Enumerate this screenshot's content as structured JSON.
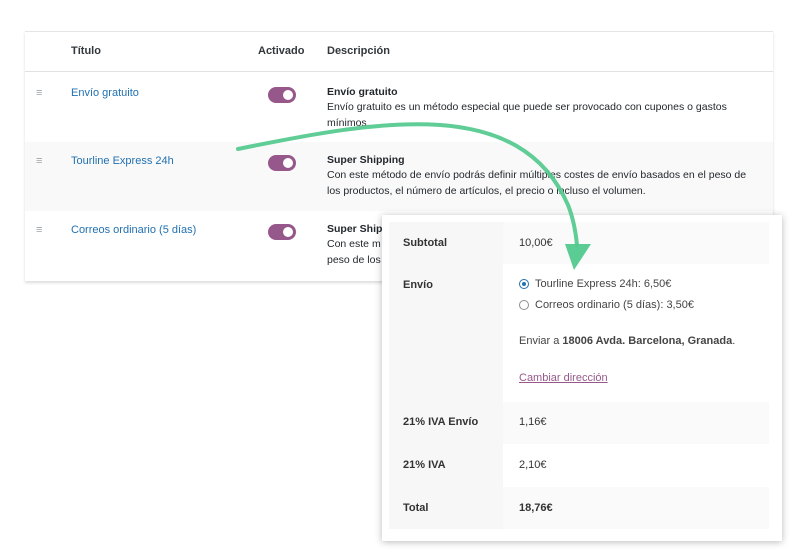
{
  "table": {
    "headers": {
      "title": "Título",
      "enabled": "Activado",
      "description": "Descripción"
    },
    "rows": [
      {
        "handle": "≡",
        "name": "Envío gratuito",
        "enabled": true,
        "desc_title": "Envío gratuito",
        "desc_text": "Envío gratuito es un método especial que puede ser provocado con cupones o gastos mínimos."
      },
      {
        "handle": "≡",
        "name": "Tourline Express 24h",
        "enabled": true,
        "desc_title": "Super Shipping",
        "desc_text": "Con este método de envío podrás definir múltiples costes de envío basados en el peso de los productos, el número de artículos, el precio o incluso el volumen."
      },
      {
        "handle": "≡",
        "name": "Correos ordinario (5 días)",
        "enabled": true,
        "desc_title": "Super Ship",
        "desc_text_line1": "Con este m",
        "desc_text_line2": "peso de los"
      }
    ]
  },
  "totals": {
    "subtotal_label": "Subtotal",
    "subtotal_value": "10,00€",
    "shipping_label": "Envío",
    "shipping_options": [
      {
        "label": "Tourline Express 24h: 6,50€",
        "checked": true
      },
      {
        "label": "Correos ordinario (5 días): 3,50€",
        "checked": false
      }
    ],
    "ship_to_prefix": "Enviar a ",
    "ship_to_address": "18006 Avda. Barcelona, Granada",
    "ship_to_suffix": ".",
    "change_address": "Cambiar dirección",
    "tax_shipping_label": "21% IVA Envío",
    "tax_shipping_value": "1,16€",
    "tax_label": "21% IVA",
    "tax_value": "2,10€",
    "total_label": "Total",
    "total_value": "18,76€"
  },
  "colors": {
    "toggle_on": "#96588a",
    "link_blue": "#2271b1",
    "arrow_green": "#52c98d"
  }
}
